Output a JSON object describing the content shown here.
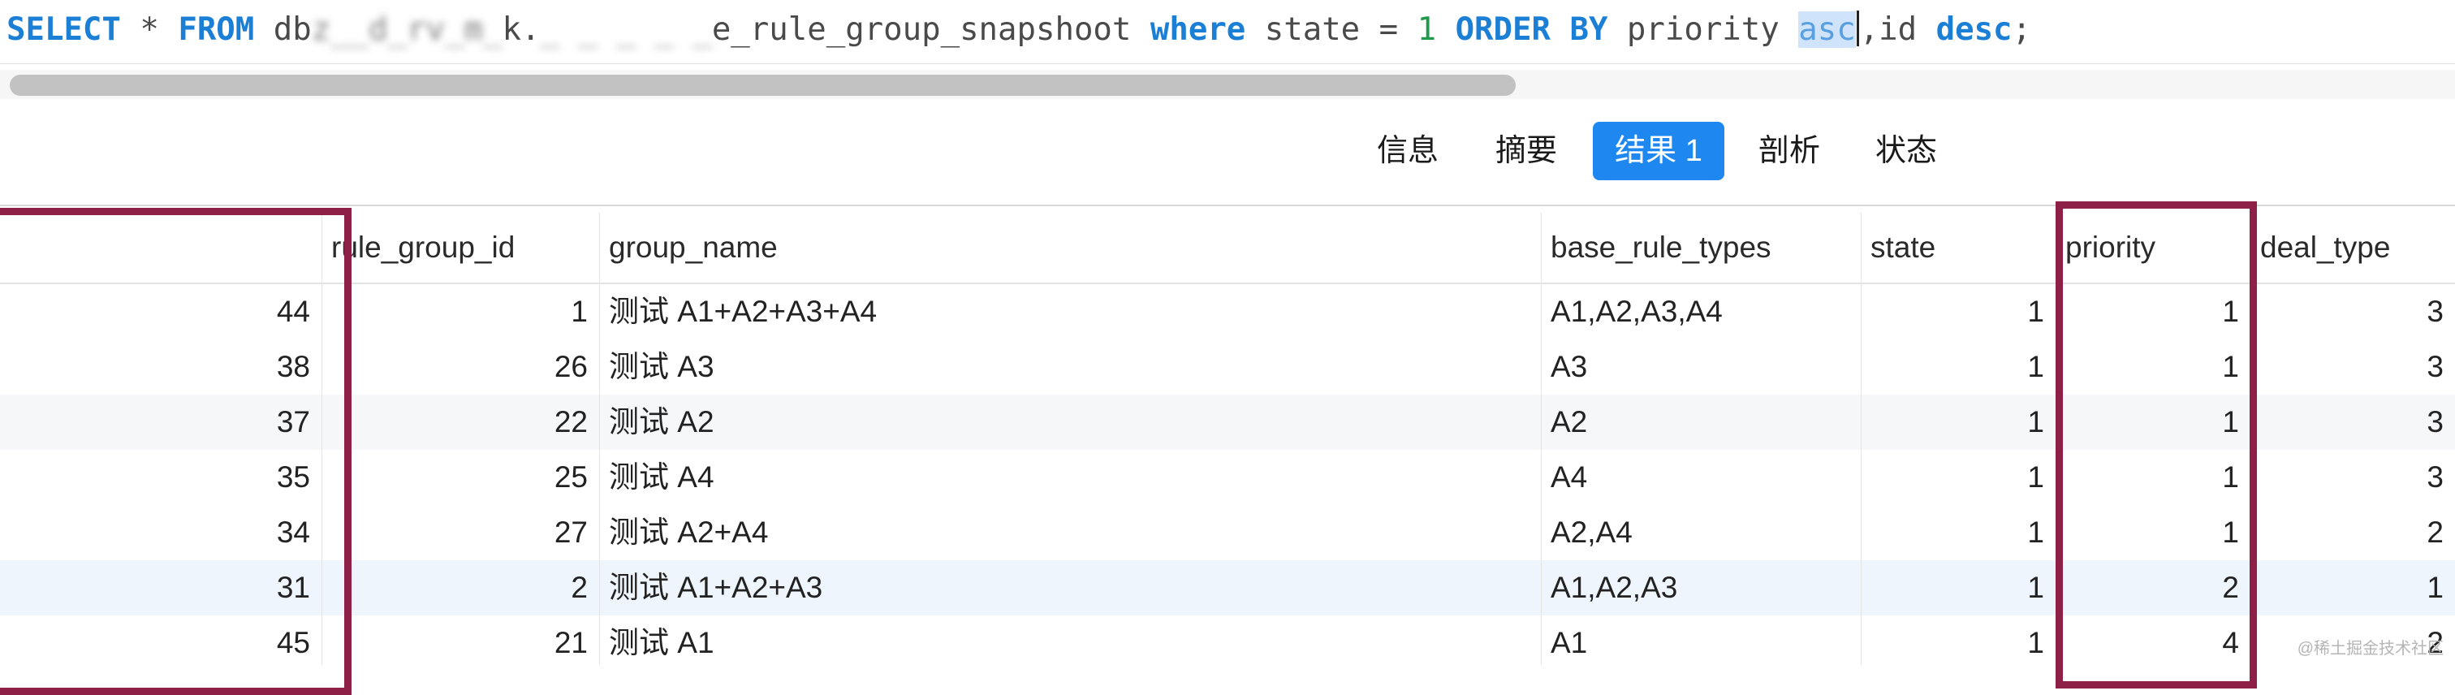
{
  "editor": {
    "tokens": [
      {
        "t": "SELECT",
        "c": "kw"
      },
      {
        "t": " * ",
        "c": "plain"
      },
      {
        "t": "FROM",
        "c": "kw"
      },
      {
        "t": " db",
        "c": "plain"
      },
      {
        "t": "z__d_rv_m_",
        "c": "blur"
      },
      {
        "t": "k.",
        "c": "plain"
      },
      {
        "t": "_ _ _ _ _",
        "c": "blur"
      },
      {
        "t": "e_rule_group_snapshoot ",
        "c": "plain"
      },
      {
        "t": "where",
        "c": "kw"
      },
      {
        "t": " state = ",
        "c": "plain"
      },
      {
        "t": "1",
        "c": "num"
      },
      {
        "t": " ",
        "c": "plain"
      },
      {
        "t": "ORDER BY",
        "c": "kw"
      },
      {
        "t": " priority ",
        "c": "plain"
      },
      {
        "t": "asc",
        "c": "sel"
      },
      {
        "t": "",
        "c": "caret"
      },
      {
        "t": ",id ",
        "c": "plain"
      },
      {
        "t": "desc",
        "c": "kw"
      },
      {
        "t": ";",
        "c": "plain"
      }
    ]
  },
  "tabs": [
    {
      "label": "信息",
      "active": false
    },
    {
      "label": "摘要",
      "active": false
    },
    {
      "label": "结果 1",
      "active": true
    },
    {
      "label": "剖析",
      "active": false
    },
    {
      "label": "状态",
      "active": false
    }
  ],
  "table": {
    "columns": [
      "",
      "rule_group_id",
      "group_name",
      "base_rule_types",
      "state",
      "priority",
      "deal_type"
    ],
    "rows": [
      [
        "44",
        "1",
        "测试 A1+A2+A3+A4",
        "A1,A2,A3,A4",
        "1",
        "1",
        "3"
      ],
      [
        "38",
        "26",
        "测试 A3",
        "A3",
        "1",
        "1",
        "3"
      ],
      [
        "37",
        "22",
        "测试 A2",
        "A2",
        "1",
        "1",
        "3"
      ],
      [
        "35",
        "25",
        "测试 A4",
        "A4",
        "1",
        "1",
        "3"
      ],
      [
        "34",
        "27",
        "测试 A2+A4",
        "A2,A4",
        "1",
        "1",
        "2"
      ],
      [
        "31",
        "2",
        "测试 A1+A2+A3",
        "A1,A2,A3",
        "1",
        "2",
        "1"
      ],
      [
        "45",
        "21",
        "测试 A1",
        "A1",
        "1",
        "4",
        "2"
      ]
    ]
  },
  "colors": {
    "keyword": "#1b7fd6",
    "number": "#1f9a4a",
    "active_tab": "#1e88f0",
    "annotation_box": "#8e1f47"
  },
  "watermark": "@稀土掘金技术社区"
}
